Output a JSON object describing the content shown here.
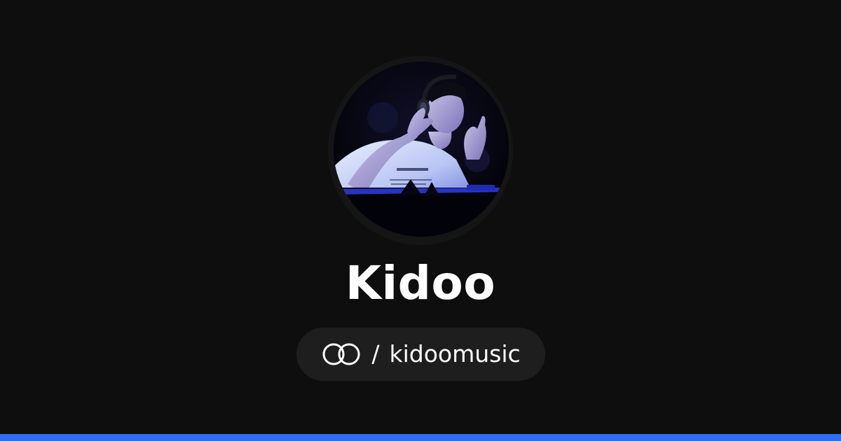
{
  "profile": {
    "name": "Kidoo",
    "avatar_alt": "",
    "separator": "/",
    "handle": "kidoomusic",
    "platform_icon": "interlocked-rings-icon"
  },
  "theme": {
    "background": "#0e0e0f",
    "pill_background": "#1e1e1f",
    "accent": "#2f6ef2",
    "text": "#ffffff"
  }
}
